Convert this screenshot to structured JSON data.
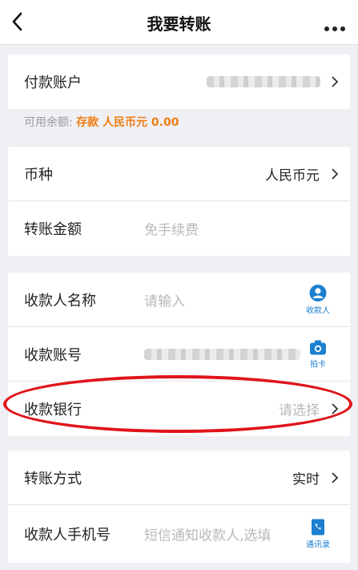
{
  "nav": {
    "title": "我要转账",
    "back_icon": "chevron-left-icon",
    "more_icon": "more-dots-icon"
  },
  "payer": {
    "label": "付款账户",
    "account_value": "redacted-blurred"
  },
  "balance": {
    "prefix": "可用余额: ",
    "highlight": "存款 人民币元 0.00",
    "accent_color": "#ef7d14"
  },
  "currency": {
    "label": "币种",
    "value": "人民币元"
  },
  "amount": {
    "label": "转账金额",
    "placeholder": "免手续费"
  },
  "payee_name": {
    "label": "收款人名称",
    "placeholder": "请输入",
    "button_caption": "收款人",
    "button_icon": "contact-person-icon"
  },
  "payee_account": {
    "label": "收款账号",
    "account_value": "redacted-blurred",
    "button_caption": "拍卡",
    "button_icon": "camera-icon"
  },
  "payee_bank": {
    "label": "收款银行",
    "placeholder": "请选择"
  },
  "transfer_mode": {
    "label": "转账方式",
    "value": "实时"
  },
  "payee_phone": {
    "label": "收款人手机号",
    "placeholder": "短信通知收款人,选填",
    "button_caption": "通讯录",
    "button_icon": "address-book-icon"
  },
  "colors": {
    "icon_blue": "#1d7fd0",
    "highlight_ring": "#e0141b"
  }
}
